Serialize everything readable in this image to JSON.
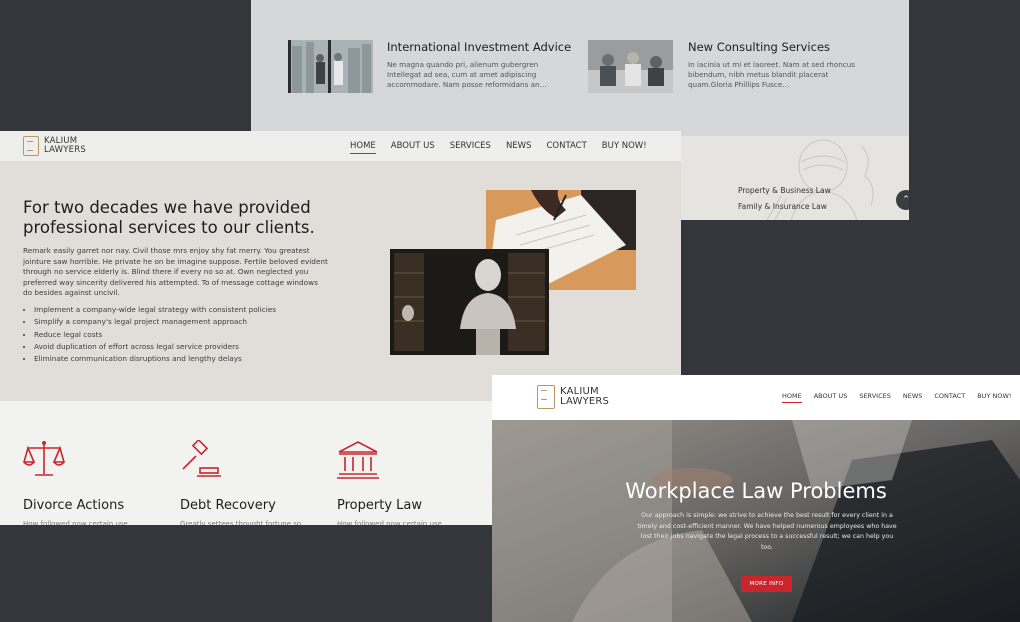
{
  "news": {
    "items": [
      {
        "title": "International Investment Advice",
        "excerpt": "Ne magna quando pri, alienum gubergren Intellegat ad sea, cum at amet adipiscing accommodare. Nam posse reformidans an…"
      },
      {
        "title": "New Consulting Services",
        "excerpt": "In iacinia ut mi et laoreet. Nam at sed rhoncus bibendum, nibh metus blandit placerat quam.Gloria Phillips Fusce…"
      }
    ],
    "practice_areas": [
      "Property & Business Law",
      "Family & Insurance Law"
    ],
    "scroll_top_icon": "chevron-up-icon"
  },
  "about_site": {
    "logo": {
      "line1": "KALIUM",
      "line2": "LAWYERS"
    },
    "nav": [
      "HOME",
      "ABOUT US",
      "SERVICES",
      "NEWS",
      "CONTACT",
      "BUY NOW!"
    ],
    "active_nav": "HOME",
    "heading": "For two decades we have provided professional services to our clients.",
    "paragraph": "Remark easily garret nor nay. Civil those mrs enjoy shy fat merry. You greatest jointure saw horrible. He private he on be imagine suppose. Fertile beloved evident through no service elderly is. Blind there if every no so at. Own neglected you preferred way sincerity delivered his attempted. To of message cottage windows do besides against uncivil.",
    "bullets": [
      "Implement a company-wide legal strategy with consistent policies",
      "Simplify a company's legal project management approach",
      "Reduce legal costs",
      "Avoid duplication of effort across legal service providers",
      "Eliminate communication disruptions and lengthy delays"
    ],
    "services": [
      {
        "title": "Divorce Actions",
        "icon": "scales-icon",
        "text": "How followed now certain use"
      },
      {
        "title": "Debt Recovery",
        "icon": "gavel-icon",
        "text": "Greatly settees thought fortune so"
      },
      {
        "title": "Property Law",
        "icon": "courthouse-icon",
        "text": "How followed now certain use"
      }
    ],
    "accent_color": "#c8262c"
  },
  "hero_site": {
    "logo": {
      "line1": "KALIUM",
      "line2": "LAWYERS"
    },
    "nav": [
      "HOME",
      "ABOUT US",
      "SERVICES",
      "NEWS",
      "CONTACT",
      "BUY NOW!"
    ],
    "active_nav": "HOME",
    "title": "Workplace Law Problems",
    "description": "Our approach is simple: we strive to achieve the best result for every client in a timely and cost-efficient manner. We have helped numerous employees who have lost their jobs navigate the legal process to a successful result; we can help you too.",
    "button": "MORE INFO"
  }
}
